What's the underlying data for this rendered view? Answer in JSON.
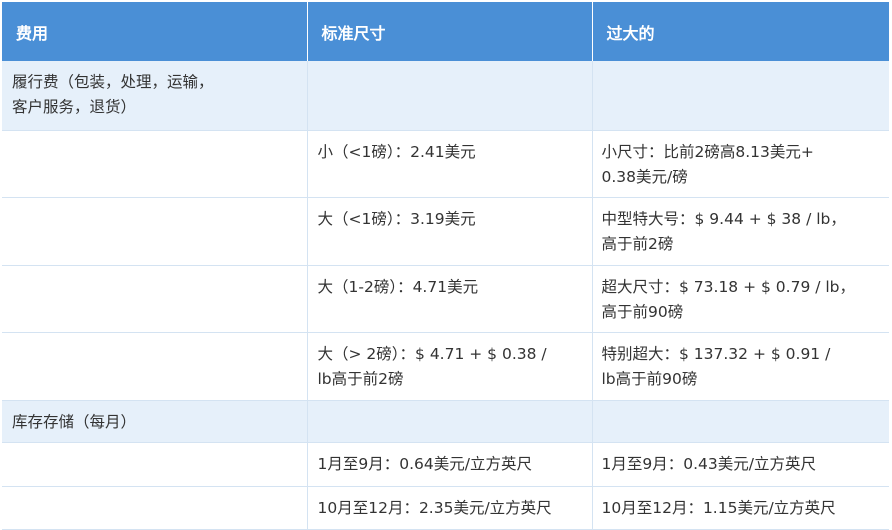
{
  "header": {
    "col1": "费用",
    "col2": "标准尺寸",
    "col3": "过大的"
  },
  "rows": [
    {
      "type": "section",
      "c1": "履行费（包装，处理，运输，\n客户服务，退货）",
      "c2": "",
      "c3": ""
    },
    {
      "type": "data",
      "c1": "",
      "c2": "小（<1磅）：2.41美元",
      "c3": "小尺寸：比前2磅高8.13美元+\n0.38美元/磅"
    },
    {
      "type": "data",
      "c1": "",
      "c2": "大（<1磅）：3.19美元",
      "c3": "中型特大号：$ 9.44 + $ 38 / lb，\n高于前2磅"
    },
    {
      "type": "data",
      "c1": "",
      "c2": "大（1-2磅）：4.71美元",
      "c3": "超大尺寸：$ 73.18 + $ 0.79 / lb，\n高于前90磅"
    },
    {
      "type": "data",
      "c1": "",
      "c2": "大（> 2磅）：$ 4.71 + $ 0.38 /\nlb高于前2磅",
      "c3": "特别超大：$ 137.32 + $ 0.91 /\nlb高于前90磅"
    },
    {
      "type": "section",
      "c1": "库存存储（每月）",
      "c2": "",
      "c3": ""
    },
    {
      "type": "data",
      "c1": "",
      "c2": "1月至9月：0.64美元/立方英尺",
      "c3": "1月至9月：0.43美元/立方英尺"
    },
    {
      "type": "data",
      "c1": "",
      "c2": "10月至12月：2.35美元/立方英尺",
      "c3": "10月至12月：1.15美元/立方英尺"
    }
  ],
  "colors": {
    "header_bg": "#4a8fd6",
    "header_text": "#ffffff",
    "section_bg": "#e6f0fa",
    "row_bg": "#ffffff",
    "border": "#d4e3f2",
    "text": "#333333"
  }
}
